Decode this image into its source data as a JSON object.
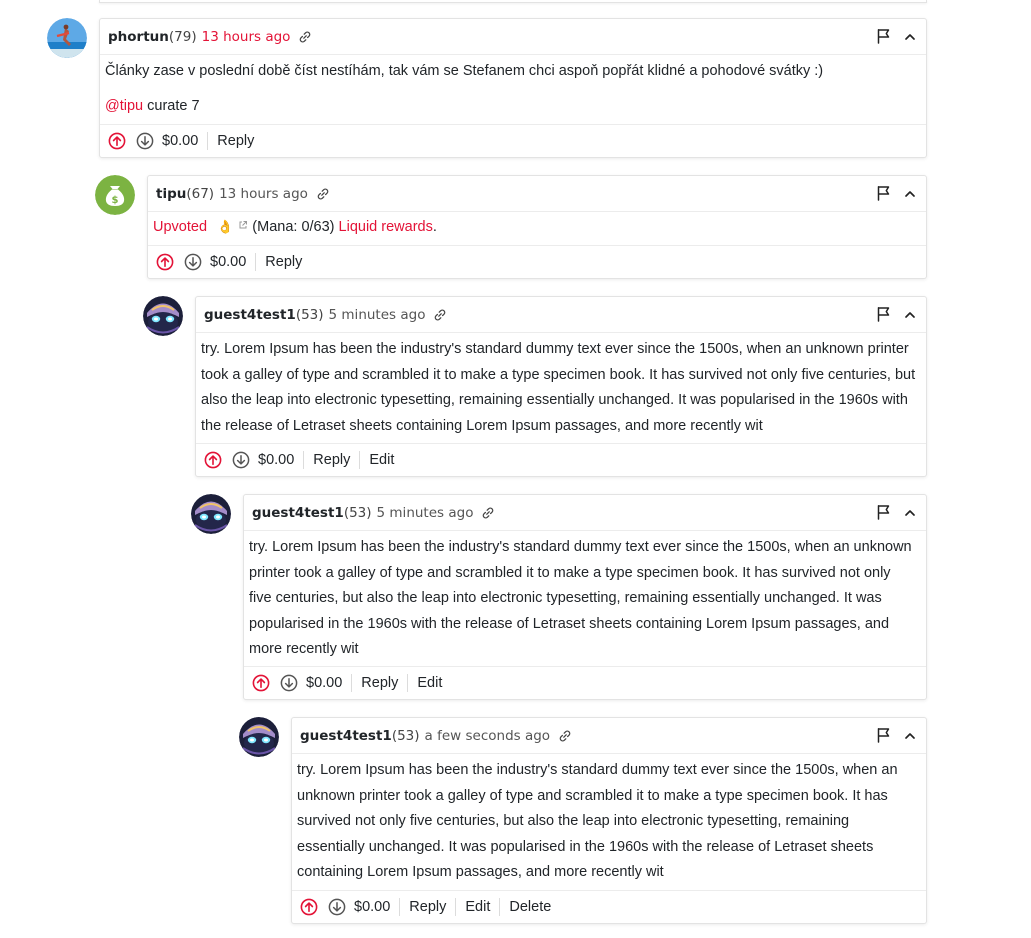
{
  "comments": [
    {
      "author": "phortun",
      "reputation": "(79)",
      "time": "13 hours ago",
      "body_line": "Články zase v poslední době číst nestíhám, tak vám se Stefanem chci aspoň popřát klidné a pohodové svátky :)",
      "mention": "@tipu",
      "mention_rest": " curate 7",
      "payout": "$0.00",
      "actions": [
        "Reply"
      ]
    },
    {
      "author": "tipu",
      "reputation": "(67)",
      "time": "13 hours ago",
      "upvoted": "Upvoted",
      "emoji": "👌",
      "mana": " (Mana: 0/63) ",
      "liquid": "Liquid rewards",
      "period": ".",
      "payout": "$0.00",
      "actions": [
        "Reply"
      ]
    },
    {
      "author": "guest4test1",
      "reputation": "(53)",
      "time": "5 minutes ago",
      "lines": [
        "try. Lorem Ipsum has been the industry's standard dummy text ever since the 1500s, when an unknown printer",
        "took a galley of type and scrambled it to make a type specimen book. It has survived not only five centuries, but",
        "also the leap into electronic typesetting, remaining essentially unchanged. It was popularised in the 1960s with",
        "the release of Letraset sheets containing Lorem Ipsum passages, and more recently wit"
      ],
      "payout": "$0.00",
      "actions": [
        "Reply",
        "Edit"
      ]
    },
    {
      "author": "guest4test1",
      "reputation": "(53)",
      "time": "5 minutes ago",
      "lines": [
        "try. Lorem Ipsum has been the industry's standard dummy text ever since the 1500s, when an unknown",
        "printer took a galley of type and scrambled it to make a type specimen book. It has survived not only",
        "five centuries, but also the leap into electronic typesetting, remaining essentially unchanged. It was",
        "popularised in the 1960s with the release of Letraset sheets containing Lorem Ipsum passages, and",
        "more recently wit"
      ],
      "payout": "$0.00",
      "actions": [
        "Reply",
        "Edit"
      ]
    },
    {
      "author": "guest4test1",
      "reputation": "(53)",
      "time": "a few seconds ago",
      "lines": [
        "try. Lorem Ipsum has been the industry's standard dummy text ever since the 1500s, when an",
        "unknown printer took a galley of type and scrambled it to make a type specimen book. It has",
        "survived not only five centuries, but also the leap into electronic typesetting, remaining",
        "essentially unchanged. It was popularised in the 1960s with the release of Letraset sheets",
        "containing Lorem Ipsum passages, and more recently wit"
      ],
      "payout": "$0.00",
      "actions": [
        "Reply",
        "Edit",
        "Delete"
      ]
    }
  ],
  "icons": {
    "upvote": "arrow-up-circle-icon",
    "downvote": "arrow-down-circle-icon",
    "flag": "flag-icon",
    "collapse": "chevron-up-icon",
    "permalink": "link-icon"
  },
  "colors": {
    "accent": "#e31337",
    "tipu_avatar": "#7cb342"
  }
}
